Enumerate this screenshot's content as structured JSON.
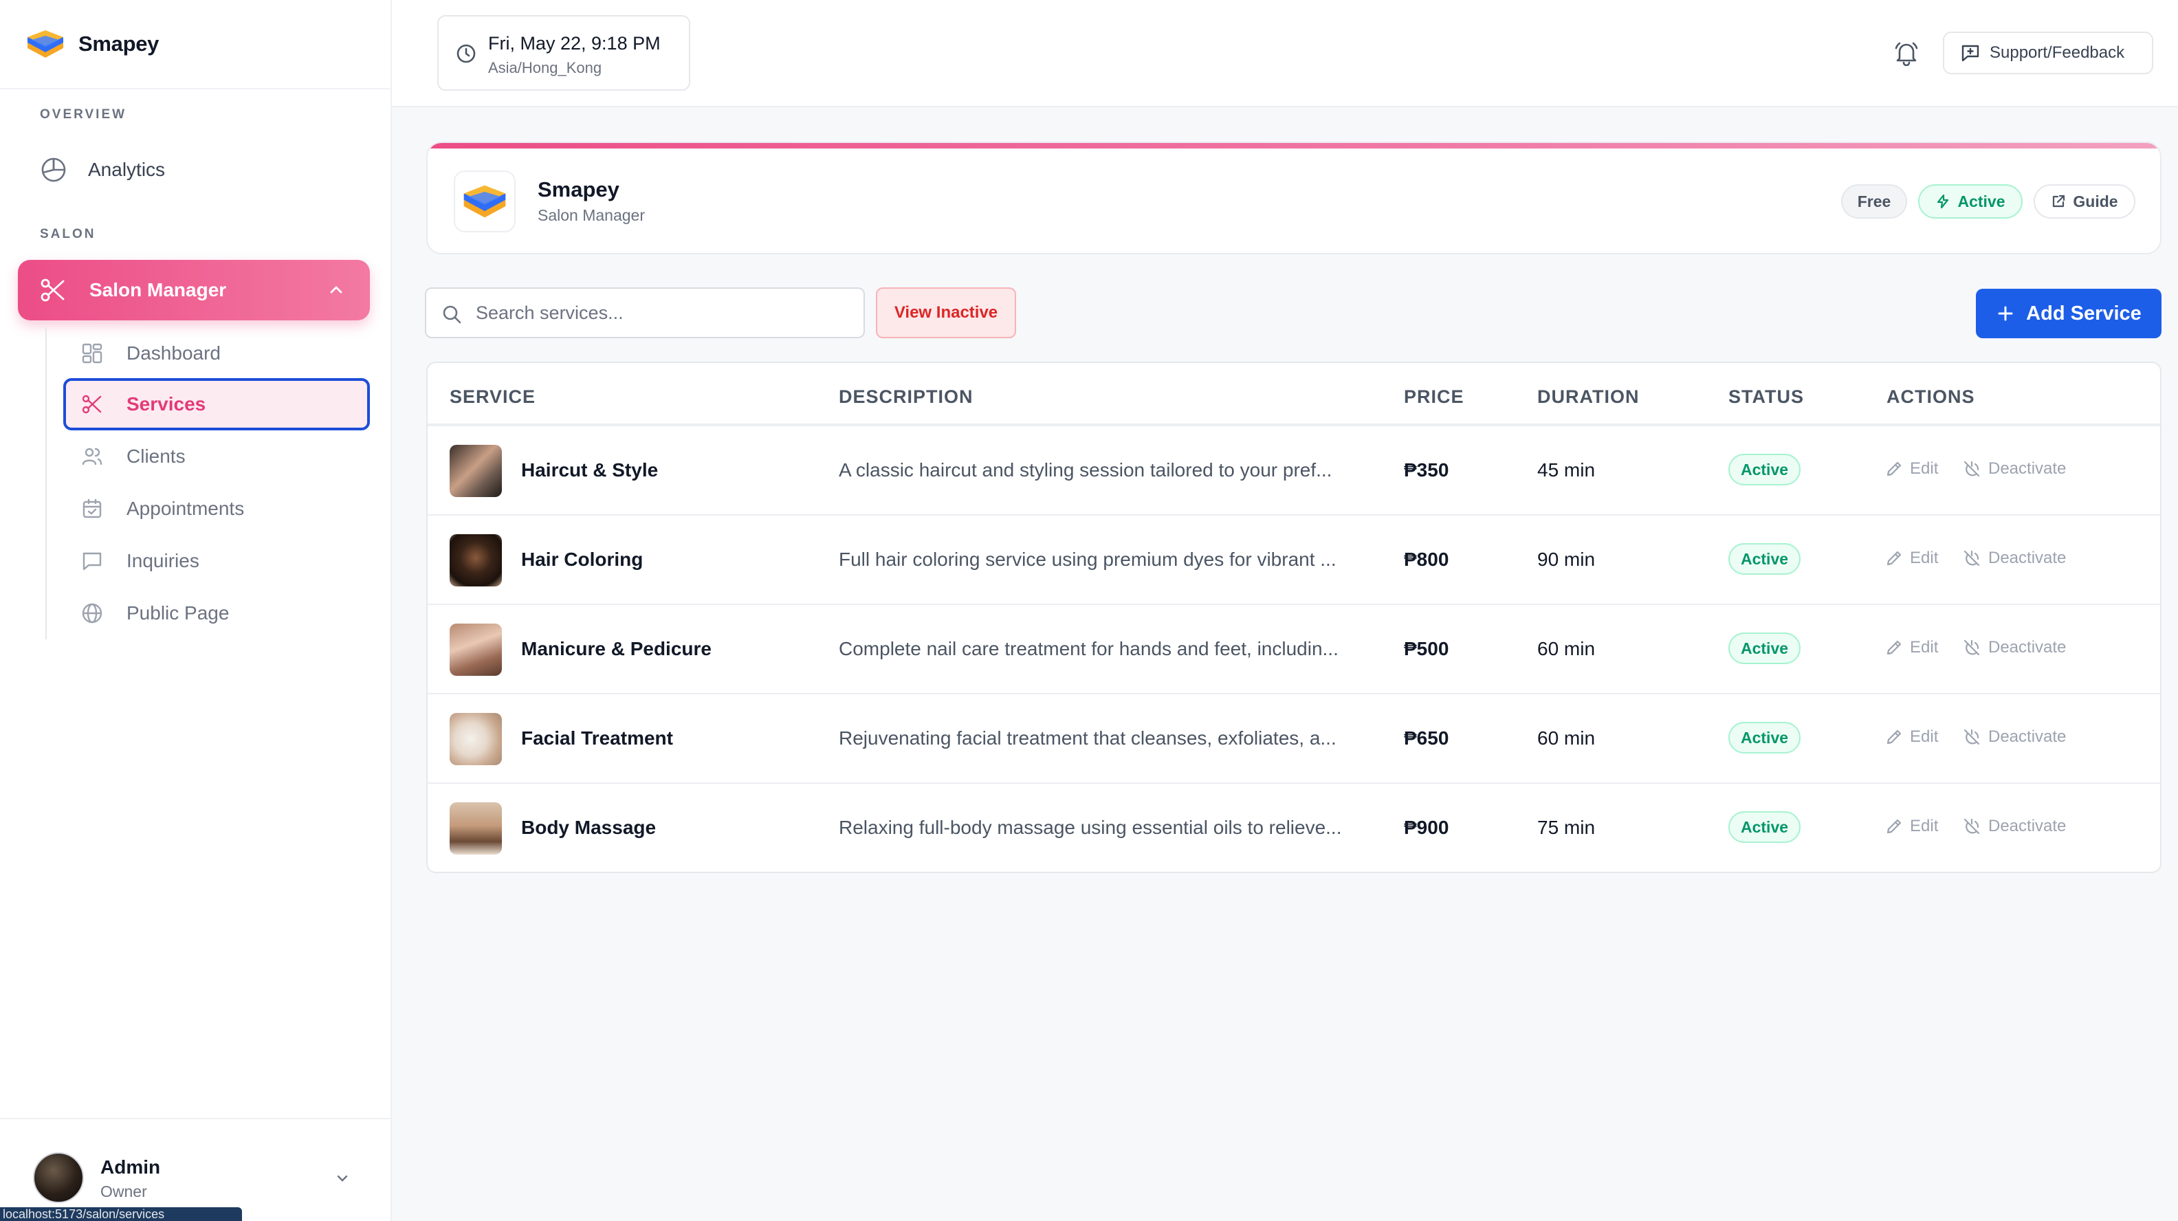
{
  "brand": {
    "name": "Smapey"
  },
  "sidebar": {
    "overview_label": "OVERVIEW",
    "analytics_label": "Analytics",
    "salon_label": "SALON",
    "salon_manager_label": "Salon Manager",
    "items": [
      {
        "label": "Dashboard",
        "icon": "grid-icon"
      },
      {
        "label": "Services",
        "icon": "scissors-icon",
        "active": true
      },
      {
        "label": "Clients",
        "icon": "users-icon"
      },
      {
        "label": "Appointments",
        "icon": "calendar-icon"
      },
      {
        "label": "Inquiries",
        "icon": "message-icon"
      },
      {
        "label": "Public Page",
        "icon": "globe-icon"
      }
    ],
    "user": {
      "name": "Admin",
      "role": "Owner"
    },
    "url_hint": "localhost:5173/salon/services"
  },
  "topbar": {
    "datetime": "Fri, May 22, 9:18 PM",
    "timezone": "Asia/Hong_Kong",
    "support_label": "Support/Feedback"
  },
  "header": {
    "title": "Smapey",
    "subtitle": "Salon Manager",
    "badges": {
      "plan": "Free",
      "status": "Active",
      "guide": "Guide"
    }
  },
  "toolbar": {
    "search_placeholder": "Search services...",
    "view_inactive_label": "View Inactive",
    "add_label": "Add Service"
  },
  "table": {
    "headers": [
      "SERVICE",
      "DESCRIPTION",
      "PRICE",
      "DURATION",
      "STATUS",
      "ACTIONS"
    ],
    "edit_label": "Edit",
    "deactivate_label": "Deactivate",
    "rows": [
      {
        "name": "Haircut & Style",
        "description": "A classic haircut and styling session tailored to your pref...",
        "price": "₱350",
        "duration": "45 min",
        "status": "Active"
      },
      {
        "name": "Hair Coloring",
        "description": "Full hair coloring service using premium dyes for vibrant ...",
        "price": "₱800",
        "duration": "90 min",
        "status": "Active"
      },
      {
        "name": "Manicure & Pedicure",
        "description": "Complete nail care treatment for hands and feet, includin...",
        "price": "₱500",
        "duration": "60 min",
        "status": "Active"
      },
      {
        "name": "Facial Treatment",
        "description": "Rejuvenating facial treatment that cleanses, exfoliates, a...",
        "price": "₱650",
        "duration": "60 min",
        "status": "Active"
      },
      {
        "name": "Body Massage",
        "description": "Relaxing full-body massage using essential oils to relieve...",
        "price": "₱900",
        "duration": "75 min",
        "status": "Active"
      }
    ]
  },
  "colors": {
    "accent_pink": "#ec4d86",
    "primary_blue": "#1d5ee8",
    "success_green": "#059669"
  }
}
